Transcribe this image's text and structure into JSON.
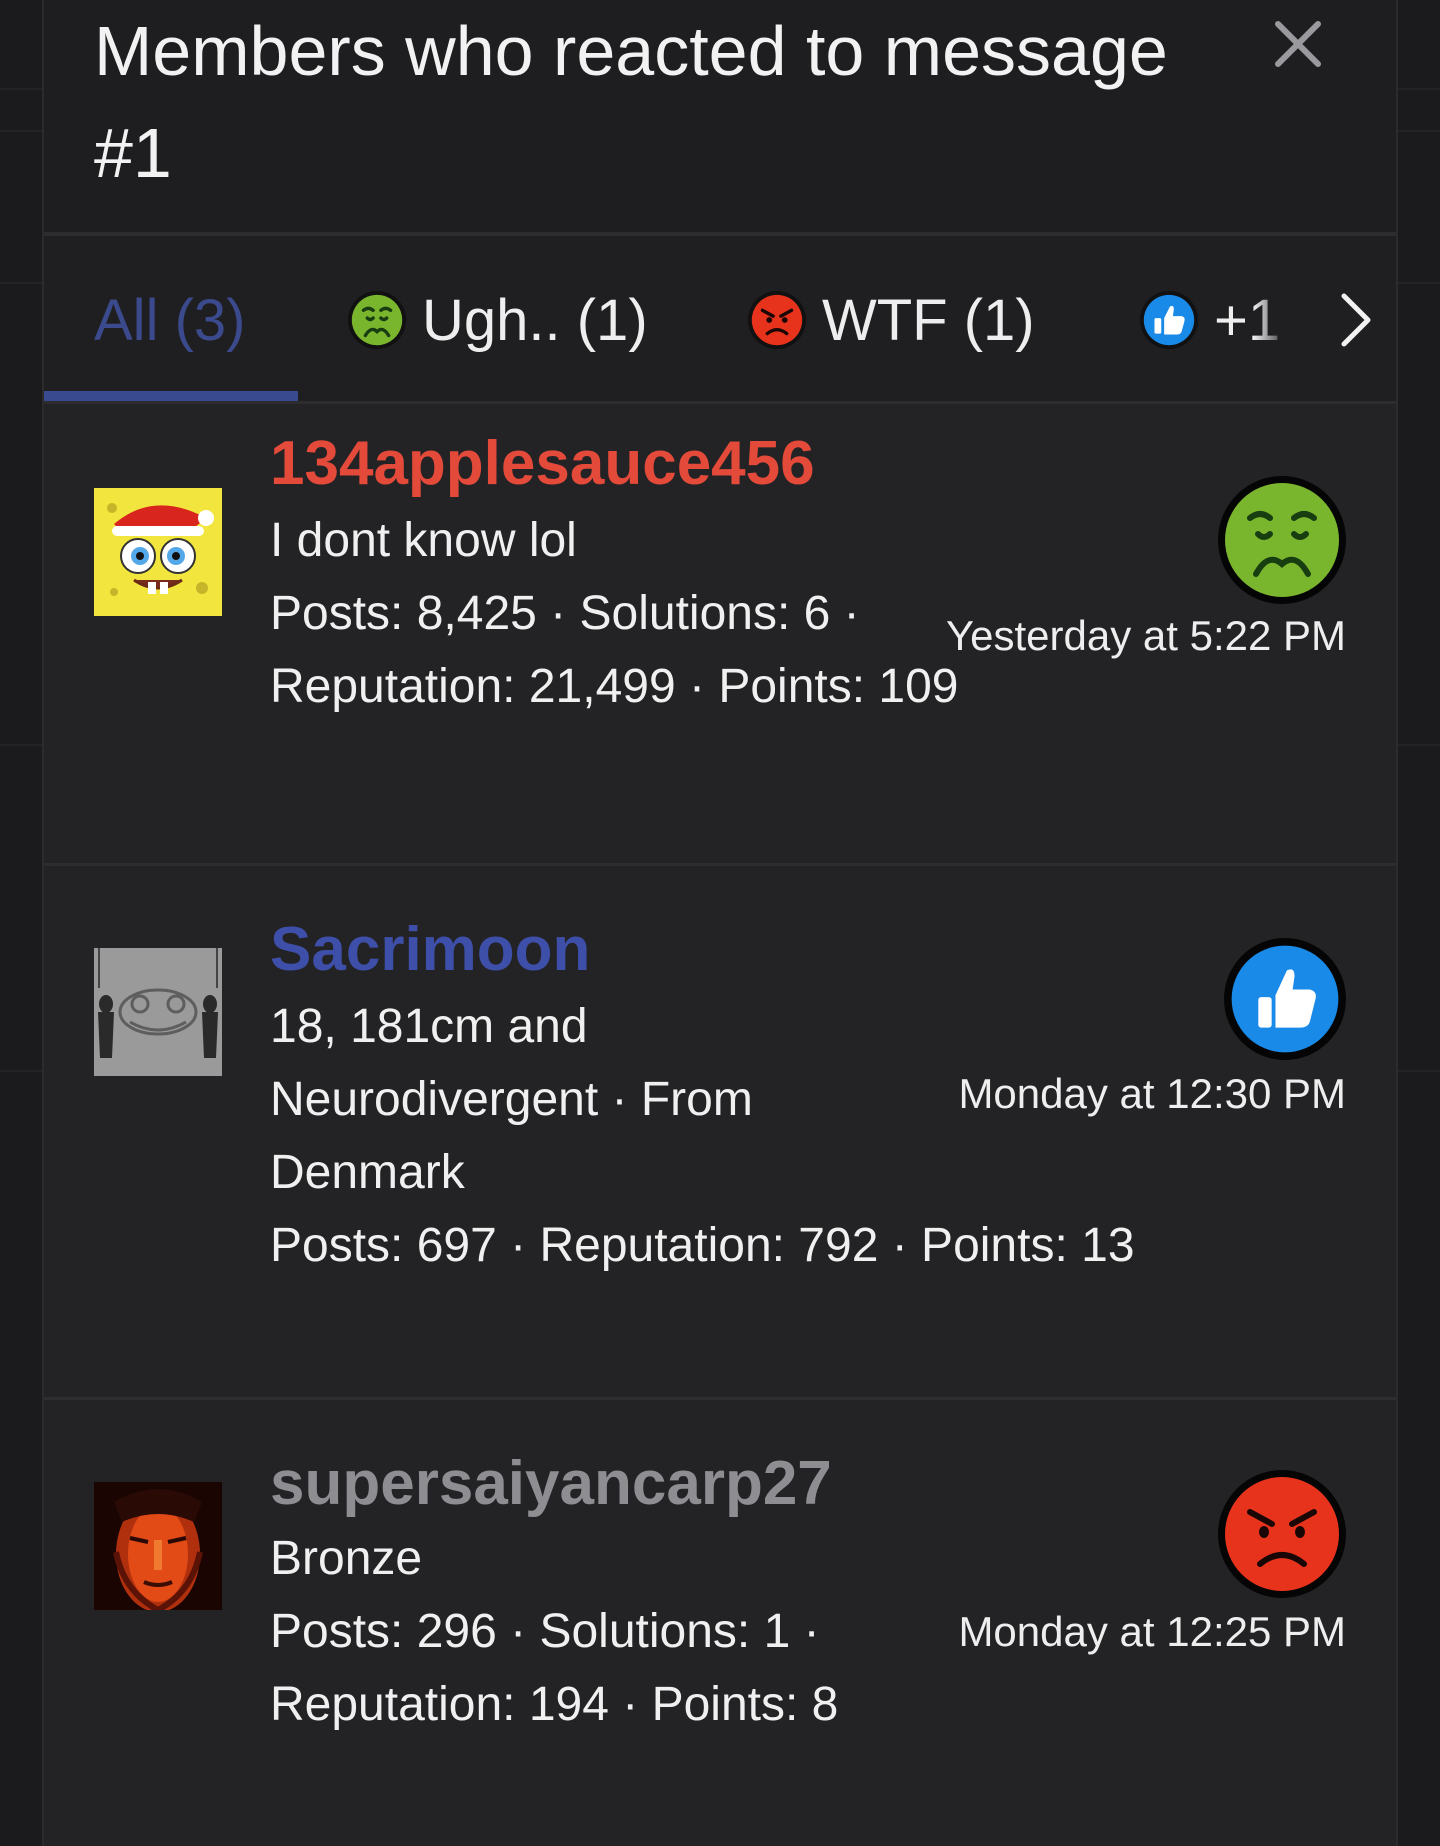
{
  "modal": {
    "title": "Members who reacted to message #1",
    "close_icon": "close-icon"
  },
  "tabs": {
    "all_label": "All (3)",
    "ugh_label": "Ugh.. (1)",
    "wtf_label": "WTF (1)",
    "more_label": "+1",
    "next_icon": "chevron-right-icon"
  },
  "members": [
    {
      "name": "134applesauce456",
      "name_color": "#e34a3a",
      "title": "I dont know lol",
      "stats": "Posts: 8,425 · Solutions: 6 · Reputation: 21,499 · Points: 109",
      "reaction": "ugh-icon",
      "time": "Yesterday at 5:22 PM"
    },
    {
      "name": "Sacrimoon",
      "name_color": "#3d4fa8",
      "title": "18, 181cm and Neurodivergent · From Denmark",
      "stats": "Posts: 697 · Reputation: 792 · Points: 13",
      "reaction": "like-icon",
      "time": "Monday at 12:30 PM"
    },
    {
      "name": "supersaiyancarp27",
      "name_color": "#8e8e92",
      "title": "Bronze",
      "stats": "Posts: 296 · Solutions: 1 · Reputation: 194 · Points: 8",
      "reaction": "wtf-icon",
      "time": "Monday at 12:25 PM"
    }
  ],
  "colors": {
    "accent": "#3a4a8f",
    "background": "#232325",
    "ugh_green": "#7ab52e",
    "wtf_red": "#e8331c",
    "like_blue": "#1a8ae8"
  }
}
